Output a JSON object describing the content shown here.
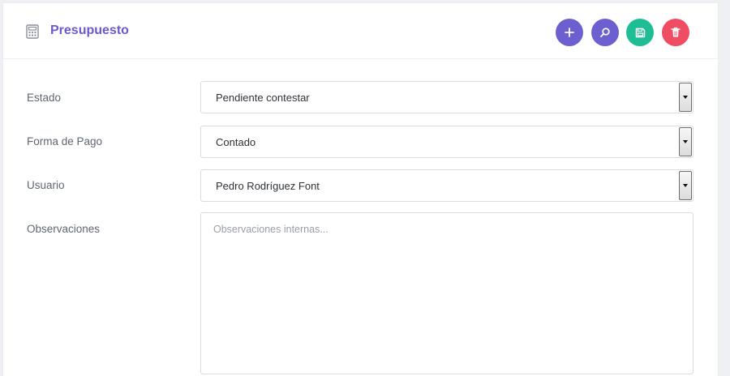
{
  "header": {
    "title": "Presupuesto",
    "icon": "calculator-icon",
    "title_color": "#6a5acd",
    "actions": [
      {
        "name": "add-button",
        "icon": "plus-icon",
        "color": "#6c5fd0"
      },
      {
        "name": "search-button",
        "icon": "magnifier-icon",
        "color": "#6c5fd0"
      },
      {
        "name": "save-button",
        "icon": "floppy-disk-icon",
        "color": "#1fbd96"
      },
      {
        "name": "delete-button",
        "icon": "trash-icon",
        "color": "#ef4d64"
      }
    ]
  },
  "form": {
    "estado": {
      "label": "Estado",
      "value": "Pendiente contestar"
    },
    "forma_pago": {
      "label": "Forma de Pago",
      "value": "Contado"
    },
    "usuario": {
      "label": "Usuario",
      "value": "Pedro Rodríguez Font"
    },
    "observaciones": {
      "label": "Observaciones",
      "placeholder": "Observaciones internas..."
    }
  }
}
